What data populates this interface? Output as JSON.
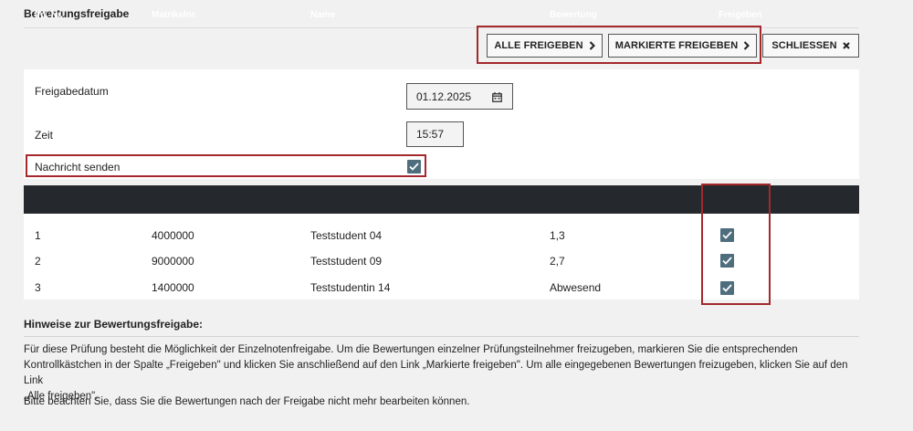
{
  "page": {
    "title": "Bewertungsfreigabe"
  },
  "toolbar": {
    "release_all_label": "ALLE FREIGEBEN",
    "release_marked_label": "MARKIERTE FREIGEBEN",
    "close_label": "SCHLIESSEN"
  },
  "form": {
    "date_label": "Freigabedatum",
    "date_value": "01.12.2025",
    "time_label": "Zeit",
    "time_value": "15:57",
    "send_message_label": "Nachricht senden",
    "send_message_checked": true
  },
  "table": {
    "headers": {
      "index": "lfd. Nr.",
      "matrikel": "Matrikelnr.",
      "name": "Name",
      "grade": "Bewertung",
      "release": "Freigeben"
    },
    "rows": [
      {
        "index": "1",
        "matrikel": "4000000",
        "name": "Teststudent 04",
        "grade": "1,3",
        "release": true
      },
      {
        "index": "2",
        "matrikel": "9000000",
        "name": "Teststudent 09",
        "grade": "2,7",
        "release": true
      },
      {
        "index": "3",
        "matrikel": "1400000",
        "name": "Teststudentin 14",
        "grade": "Abwesend",
        "release": true
      }
    ]
  },
  "notes": {
    "title": "Hinweise zur Bewertungsfreigabe:",
    "paragraph1_line1": "Für diese Prüfung besteht die Möglichkeit der Einzelnotenfreigabe. Um die Bewertungen einzelner Prüfungsteilnehmer freizugeben, markieren Sie die entsprechenden",
    "paragraph1_line2": "Kontrollkästchen in der Spalte „Freigeben\" und klicken Sie anschließend auf den Link „Markierte freigeben\". Um alle eingegebenen Bewertungen freizugeben, klicken Sie auf den Link",
    "paragraph1_line3": "„Alle freigeben\".",
    "paragraph2": "Bitte beachten Sie, dass Sie die Bewertungen nach der Freigabe nicht mehr bearbeiten können."
  },
  "colors": {
    "highlight": "#a3292d",
    "checkbox": "#4e6e7e",
    "table_header": "#25282d"
  },
  "icons": [
    "chevron-right-icon",
    "close-x-icon",
    "calendar-icon",
    "checkmark-icon"
  ]
}
